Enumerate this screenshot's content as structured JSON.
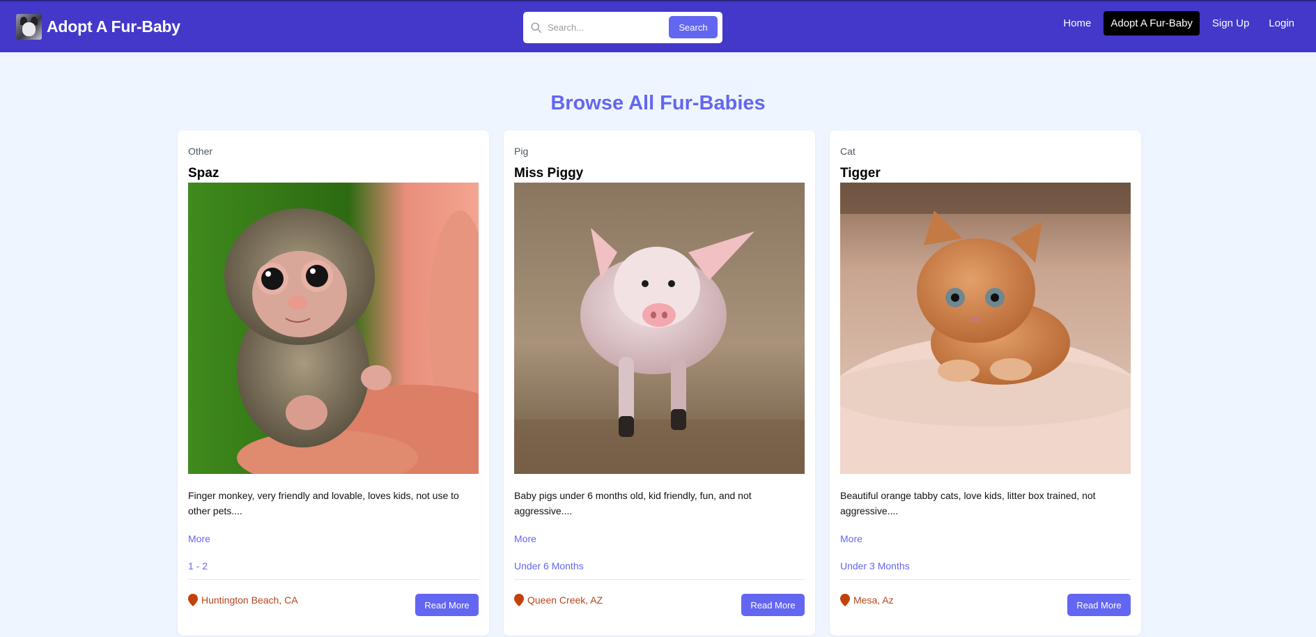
{
  "header": {
    "brand": "Adopt A Fur-Baby",
    "search": {
      "placeholder": "Search...",
      "button": "Search"
    },
    "nav": [
      {
        "label": "Home",
        "active": false
      },
      {
        "label": "Adopt A Fur-Baby",
        "active": true
      },
      {
        "label": "Sign Up",
        "active": false
      },
      {
        "label": "Login",
        "active": false
      }
    ]
  },
  "main": {
    "title": "Browse All Fur-Babies",
    "cards": [
      {
        "category": "Other",
        "name": "Spaz",
        "image_subject": "finger monkey",
        "description": "Finger monkey, very friendly and lovable, loves kids, not use to other pets....",
        "more": "More",
        "age": "1 - 2",
        "location": "Huntington Beach, CA",
        "button": "Read More"
      },
      {
        "category": "Pig",
        "name": "Miss Piggy",
        "image_subject": "piglet",
        "description": "Baby pigs under 6 months old, kid friendly, fun, and not aggressive....",
        "more": "More",
        "age": "Under 6 Months",
        "location": "Queen Creek, AZ",
        "button": "Read More"
      },
      {
        "category": "Cat",
        "name": "Tigger",
        "image_subject": "orange tabby kitten",
        "description": "Beautiful orange tabby cats, love kids, litter box trained, not aggressive....",
        "more": "More",
        "age": "Under 3 Months",
        "location": "Mesa, Az",
        "button": "Read More"
      }
    ]
  },
  "colors": {
    "navbar": "#4338ca",
    "accent": "#6366f1",
    "page_bg": "#eff5fe",
    "location": "#b5441a",
    "active_nav": "#000000"
  }
}
